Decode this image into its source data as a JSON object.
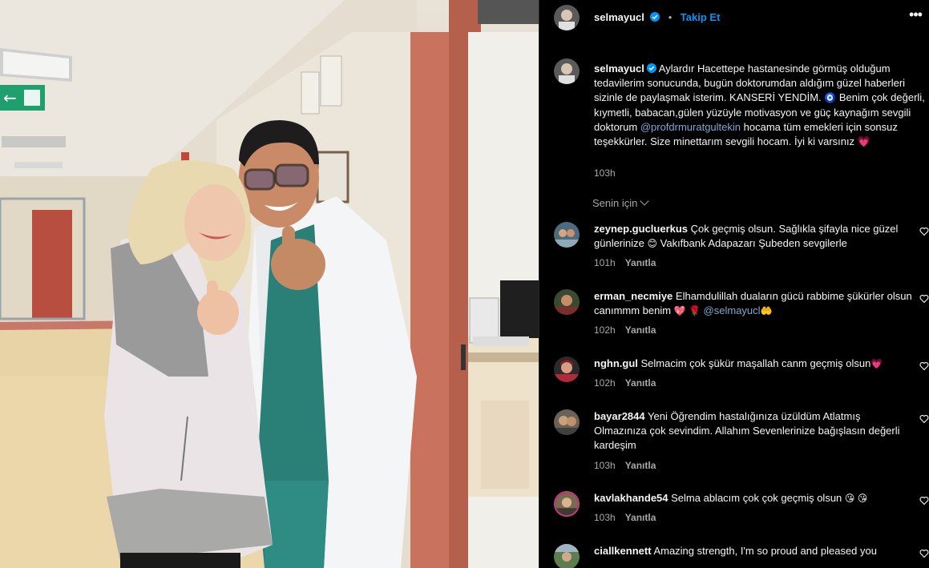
{
  "post": {
    "author": "selmayucl",
    "follow_label": "Takip Et",
    "more_label": "•••",
    "caption_parts": {
      "p1": "Aylardır Hacettepe hastanesinde görmüş olduğum tedavilerim sonucunda, bugün doktorumdan aldığım güzel haberleri sizinle de paylaşmak isterim. KANSERİ YENDİM. ",
      "nazar": "🧿",
      "p2": " Benim çok değerli, kıymetli, babacan,gülen yüzüyle motivasyon ve güç kaynağım sevgili doktorum ",
      "mention": "@profdrmuratgultekin",
      "p3": " hocama tüm emekleri için sonsuz teşekkürler. Size minettarım sevgili hocam. İyi ki varsınız ",
      "heart": "💗"
    },
    "time": "103h"
  },
  "sort_label": "Senin için",
  "reply_label": "Yanıtla",
  "comments": [
    {
      "user": "zeynep.gucluerkus",
      "text": "Çok geçmiş olsun. Sağlıkla şifayla nice güzel günlerinize ",
      "emoji": "😊",
      "text2": " Vakıfbank Adapazarı Şubeden sevgilerle",
      "time": "101h"
    },
    {
      "user": "erman_necmiye",
      "text": "Elhamdulillah duaların gücü rabbime şükürler olsun canımmm benim ",
      "emoji": "💖 🌹",
      "mention": "@selmayucl",
      "emoji2": "🤲",
      "time": "102h"
    },
    {
      "user": "nghn.gul",
      "text": "Selmacim çok şükür maşallah canm geçmiş olsun",
      "emoji": "💗",
      "time": "102h"
    },
    {
      "user": "bayar2844",
      "text": "Yeni Öğrendim hastalığınıza üzüldüm Atlatmış Olmazınıza çok sevindim. Allahım Sevenlerinize bağışlasın değerli kardeşim",
      "time": "103h"
    },
    {
      "user": "kavlakhande54",
      "text": "Selma ablacım çok çok geçmiş olsun ",
      "emoji": "😘 😘",
      "time": "103h"
    },
    {
      "user": "ciallkennett",
      "text": "Amazing strength, I'm so proud and pleased you"
    }
  ],
  "colors": {
    "accent": "#0095f6",
    "verified": "#0095f6",
    "muted": "#a8a8a8",
    "mention": "#7fa6d6"
  },
  "icons": [
    "verified-badge-icon",
    "more-options-icon",
    "chevron-down-icon",
    "heart-outline-icon"
  ]
}
